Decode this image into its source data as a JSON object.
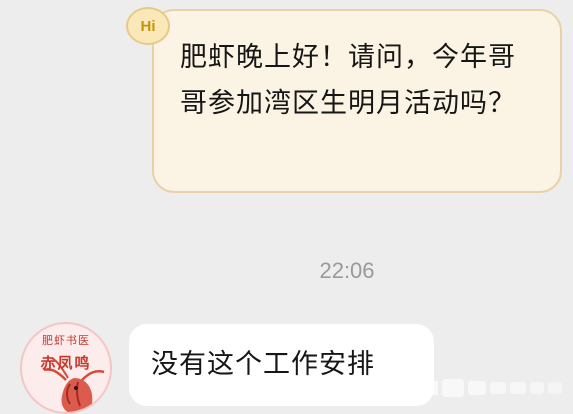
{
  "chat": {
    "outgoing": {
      "badge": "Hi",
      "text": "肥虾晚上好！请问，今年哥哥参加湾区生明月活动吗？"
    },
    "timestamp": "22:06",
    "incoming": {
      "avatar_caption_top": "肥虾书医",
      "avatar_caption_bottom": "赤凤鸣",
      "text": "没有这个工作安排"
    }
  },
  "colors": {
    "background": "#ededed",
    "outgoing_bubble": "#fbf3e3",
    "outgoing_border": "#e7d1a6",
    "incoming_bubble": "#ffffff",
    "timestamp": "#9a9a9a",
    "avatar_accent": "#c53a2e"
  },
  "icons": {
    "avatar": "shrimp-logo-icon",
    "badge": "hi-badge-icon"
  }
}
